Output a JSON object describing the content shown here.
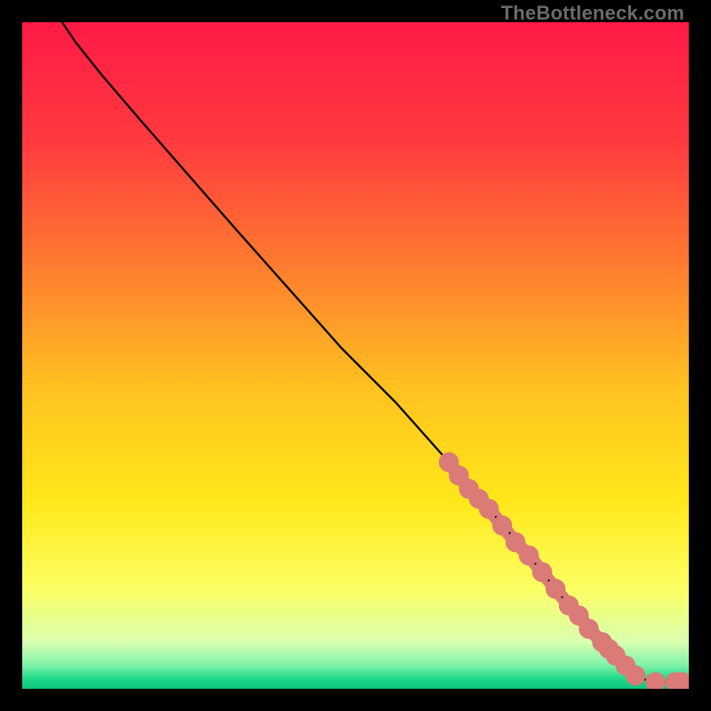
{
  "watermark": "TheBottleneck.com",
  "chart_data": {
    "type": "line",
    "title": "",
    "xlabel": "",
    "ylabel": "",
    "xlim": [
      0,
      100
    ],
    "ylim": [
      0,
      100
    ],
    "curve": {
      "x": [
        6,
        8,
        12,
        18,
        25,
        32,
        40,
        48,
        56,
        64,
        70,
        76,
        80,
        84,
        88,
        91,
        93,
        95,
        97,
        99
      ],
      "y": [
        100,
        97,
        92,
        85,
        77,
        69,
        60,
        51,
        43,
        34,
        27,
        20,
        15,
        10,
        6,
        3,
        1.5,
        1,
        1,
        1
      ]
    },
    "scatter": {
      "x": [
        64,
        65.5,
        67,
        68.5,
        70,
        72,
        74,
        76,
        78,
        80,
        82,
        83.5,
        85,
        87,
        88,
        89,
        90.5,
        92,
        95,
        98,
        99
      ],
      "y": [
        34,
        32,
        30,
        28.5,
        27,
        24.5,
        22,
        20,
        17.5,
        15,
        12.5,
        11,
        9,
        7,
        6,
        5,
        3.5,
        2,
        1,
        1,
        1
      ]
    },
    "gradient_stops": [
      {
        "pos": 0.0,
        "color": "#ff1a45"
      },
      {
        "pos": 0.18,
        "color": "#ff3a3f"
      },
      {
        "pos": 0.36,
        "color": "#ff7a30"
      },
      {
        "pos": 0.55,
        "color": "#ffc220"
      },
      {
        "pos": 0.72,
        "color": "#ffe81a"
      },
      {
        "pos": 0.85,
        "color": "#fcff63"
      },
      {
        "pos": 0.93,
        "color": "#d9ffb0"
      },
      {
        "pos": 0.965,
        "color": "#7ef2a8"
      },
      {
        "pos": 0.985,
        "color": "#1fd98a"
      },
      {
        "pos": 1.0,
        "color": "#0cc47e"
      }
    ]
  }
}
